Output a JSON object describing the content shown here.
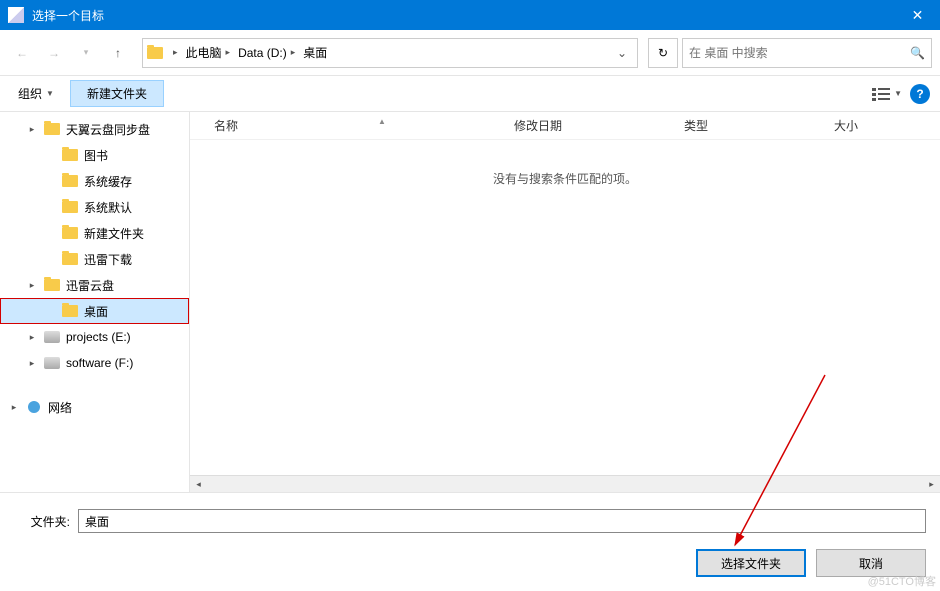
{
  "title": "选择一个目标",
  "breadcrumbs": [
    "此电脑",
    "Data (D:)",
    "桌面"
  ],
  "search_placeholder": "在 桌面 中搜索",
  "toolbar": {
    "organize": "组织",
    "new_folder": "新建文件夹"
  },
  "tree": [
    {
      "icon": "folder",
      "label": "天翼云盘同步盘",
      "indent": 1,
      "exp": "▸"
    },
    {
      "icon": "folder",
      "label": "图书",
      "indent": 2,
      "exp": ""
    },
    {
      "icon": "folder",
      "label": "系统缓存",
      "indent": 2,
      "exp": ""
    },
    {
      "icon": "folder",
      "label": "系统默认",
      "indent": 2,
      "exp": ""
    },
    {
      "icon": "folder",
      "label": "新建文件夹",
      "indent": 2,
      "exp": ""
    },
    {
      "icon": "folder",
      "label": "迅雷下载",
      "indent": 2,
      "exp": ""
    },
    {
      "icon": "folder",
      "label": "迅雷云盘",
      "indent": 1,
      "exp": "▸"
    },
    {
      "icon": "folder",
      "label": "桌面",
      "indent": 2,
      "exp": "",
      "selected": true,
      "highlight": true
    },
    {
      "icon": "drive",
      "label": "projects (E:)",
      "indent": 1,
      "exp": "▸"
    },
    {
      "icon": "drive",
      "label": "software (F:)",
      "indent": 1,
      "exp": "▸"
    },
    {
      "gap": true
    },
    {
      "icon": "network",
      "label": "网络",
      "indent": 0,
      "exp": "▸"
    }
  ],
  "columns": {
    "name": "名称",
    "date": "修改日期",
    "type": "类型",
    "size": "大小"
  },
  "empty_text": "没有与搜索条件匹配的项。",
  "folder_label": "文件夹:",
  "folder_value": "桌面",
  "btn_select": "选择文件夹",
  "btn_cancel": "取消",
  "watermark": "@51CTO博客"
}
